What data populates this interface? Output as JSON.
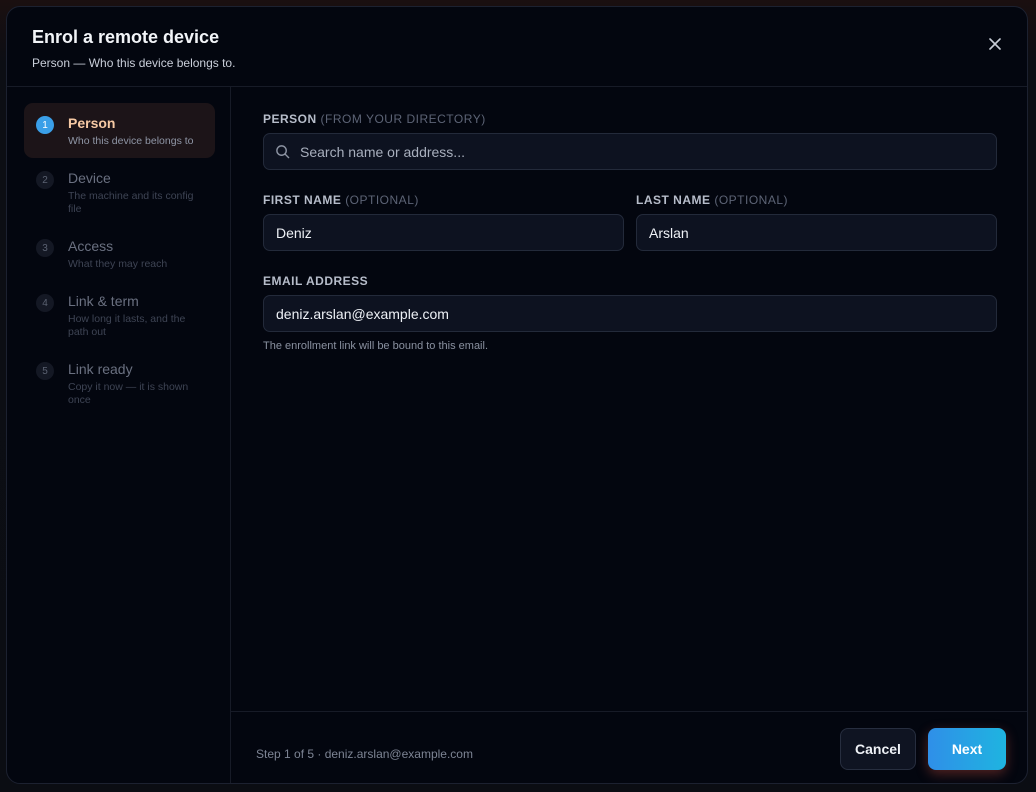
{
  "dialog": {
    "title": "Enrol a remote device",
    "subtitle": "Person — Who this device belongs to.",
    "close_icon": "close-icon"
  },
  "steps": [
    {
      "number": "1",
      "label": "Person",
      "description": "Who this device belongs to",
      "active": true
    },
    {
      "number": "2",
      "label": "Device",
      "description": "The machine and its config file",
      "active": false
    },
    {
      "number": "3",
      "label": "Access",
      "description": "What they may reach",
      "active": false
    },
    {
      "number": "4",
      "label": "Link & term",
      "description": "How long it lasts, and the path out",
      "active": false
    },
    {
      "number": "5",
      "label": "Link ready",
      "description": "Copy it now — it is shown once",
      "active": false
    }
  ],
  "form": {
    "person": {
      "label": "Person",
      "label_note": "(from your directory)",
      "placeholder": "Search name or address...",
      "value": ""
    },
    "first_name": {
      "label": "First name",
      "label_note": "(optional)",
      "value": "Deniz"
    },
    "last_name": {
      "label": "Last name",
      "label_note": "(optional)",
      "value": "Arslan"
    },
    "email": {
      "label": "Email address",
      "value": "deniz.arslan@example.com",
      "helper": "The enrollment link will be bound to this email."
    }
  },
  "footer": {
    "status": "Step 1 of 5 · deniz.arslan@example.com",
    "cancel_label": "Cancel",
    "next_label": "Next"
  },
  "colors": {
    "accent": "#2f8fe8",
    "accent_end": "#1fb4e0",
    "active_step_label": "#f6c9a4",
    "modal_bg": "#03060f"
  }
}
